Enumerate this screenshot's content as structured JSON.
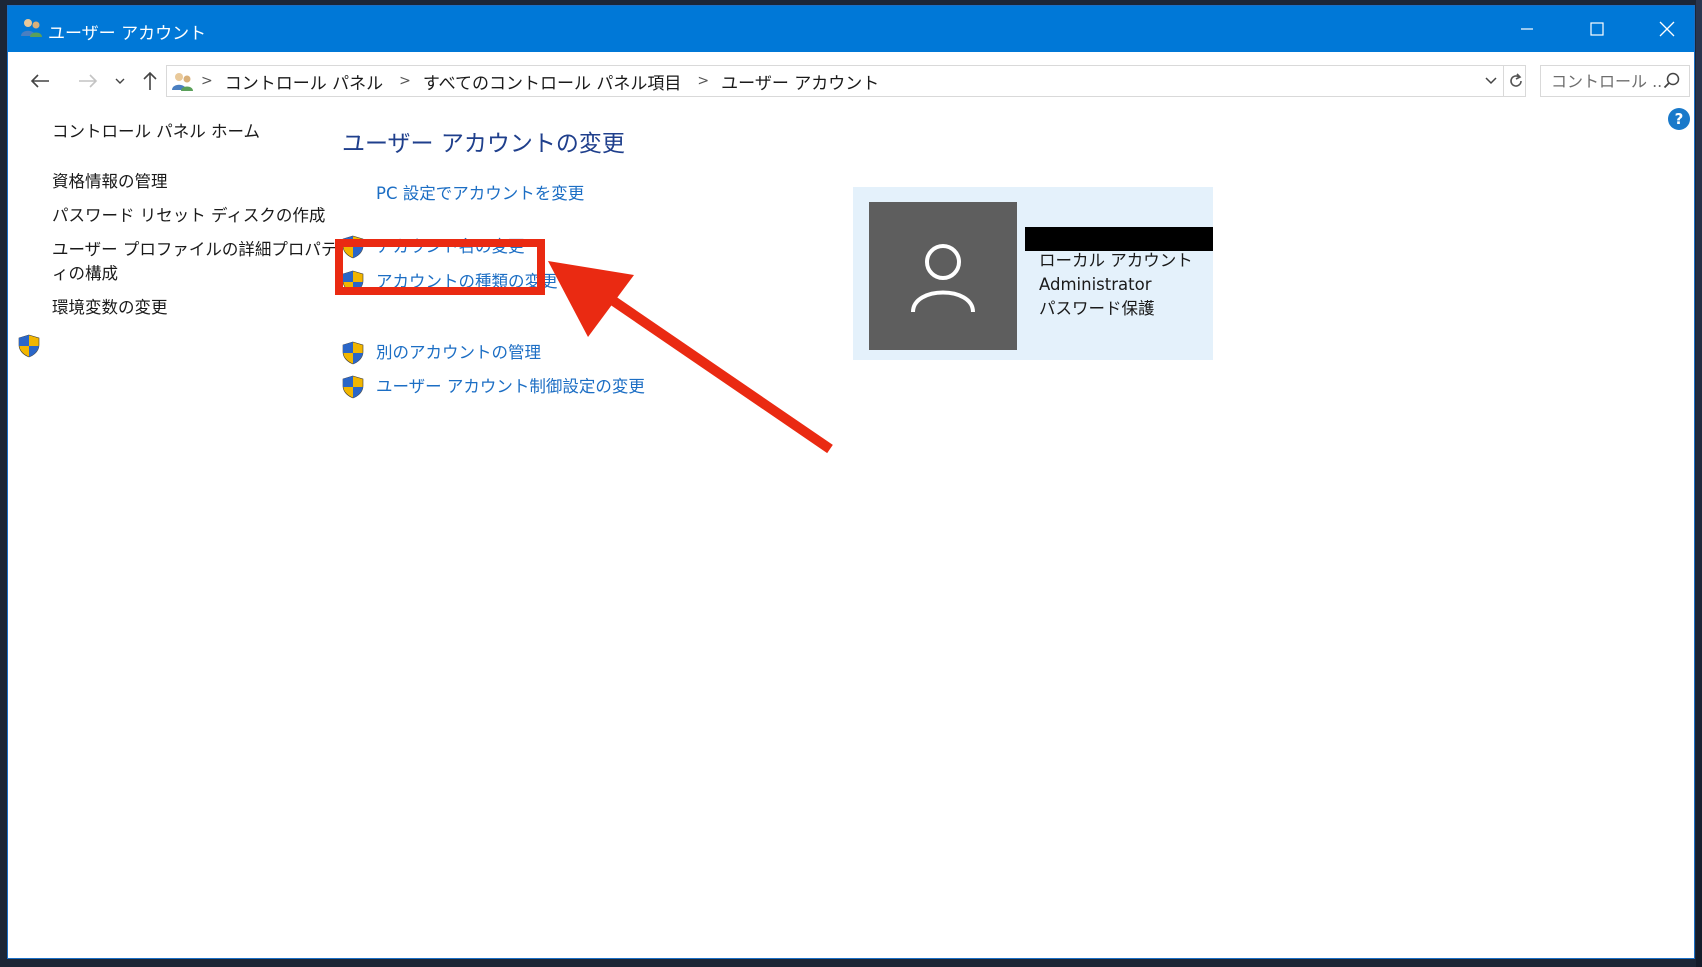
{
  "window": {
    "title": "ユーザー アカウント"
  },
  "titlebar_buttons": {
    "minimize": "minimize-icon",
    "maximize": "maximize-icon",
    "close": "close-icon"
  },
  "navigation": {
    "back": "back-arrow-icon",
    "forward": "forward-arrow-icon",
    "recent": "chevron-down-icon",
    "up": "up-arrow-icon"
  },
  "address": {
    "breadcrumbs": [
      "コントロール パネル",
      "すべてのコントロール パネル項目",
      "ユーザー アカウント"
    ]
  },
  "search": {
    "placeholder": "コントロール ..."
  },
  "help": {
    "label": "?"
  },
  "sidebar": {
    "items": [
      {
        "label": "コントロール パネル ホーム"
      },
      {
        "label": "資格情報の管理"
      },
      {
        "label": "パスワード リセット ディスクの作成"
      },
      {
        "label": "ユーザー プロファイルの詳細プロパティの構成",
        "line1": "ユーザー プロファイルの詳細プロパテ",
        "line2": "ィの構成",
        "shield": true
      },
      {
        "label": "環境変数の変更"
      }
    ]
  },
  "main": {
    "title": "ユーザー アカウントの変更",
    "tasks": [
      {
        "label": "PC 設定でアカウントを変更",
        "shield": false
      },
      {
        "label": "アカウント名の変更",
        "shield": true
      },
      {
        "label": "アカウントの種類の変更",
        "shield": true
      },
      {
        "label": "別のアカウントの管理",
        "shield": true
      },
      {
        "label": "ユーザー アカウント制御設定の変更",
        "shield": true
      }
    ]
  },
  "account": {
    "type": "ローカル アカウント",
    "group": "Administrator",
    "protection": "パスワード保護"
  },
  "colors": {
    "titlebar": "#0078d7",
    "link": "#1c6ec4",
    "heading": "#1f3f8c",
    "annotation": "#ea2a12",
    "card": "#e4f1fb"
  }
}
